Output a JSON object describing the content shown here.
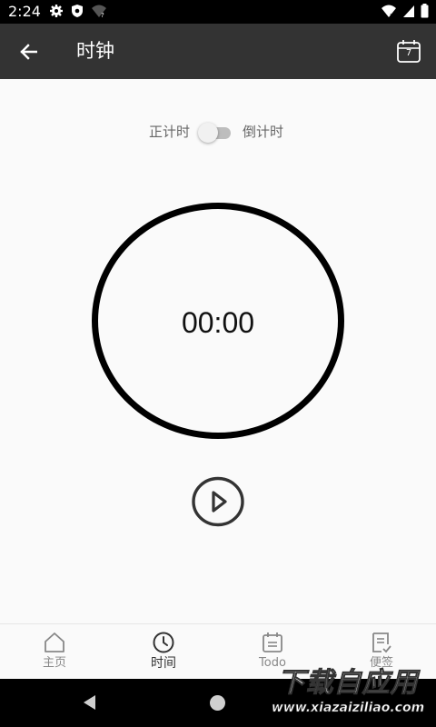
{
  "status_bar": {
    "time": "2:24",
    "icons_left": [
      "gear-icon",
      "shield-icon",
      "wifi-question-icon"
    ],
    "icons_right": [
      "wifi-x-icon",
      "signal-icon",
      "battery-icon"
    ]
  },
  "app_bar": {
    "title": "时钟",
    "back_icon": "arrow-left-icon",
    "calendar_day": "7"
  },
  "mode_switch": {
    "up_label": "正计时",
    "down_label": "倒计时",
    "checked": false
  },
  "timer": {
    "display": "00:00",
    "action_icon": "play-icon"
  },
  "bottom_nav": {
    "items": [
      {
        "label": "主页",
        "icon": "home-icon",
        "active": false
      },
      {
        "label": "时间",
        "icon": "clock-icon",
        "active": true
      },
      {
        "label": "Todo",
        "icon": "calendar-icon",
        "active": false
      },
      {
        "label": "便签",
        "icon": "note-icon",
        "active": false
      }
    ]
  },
  "watermark": {
    "text": "下载自应用",
    "url": "www.xiazaiziliao.com"
  },
  "colors": {
    "app_bar": "#333333",
    "background": "#fafafa",
    "ring": "#000000",
    "toggle_track": "#bdbdbd"
  }
}
